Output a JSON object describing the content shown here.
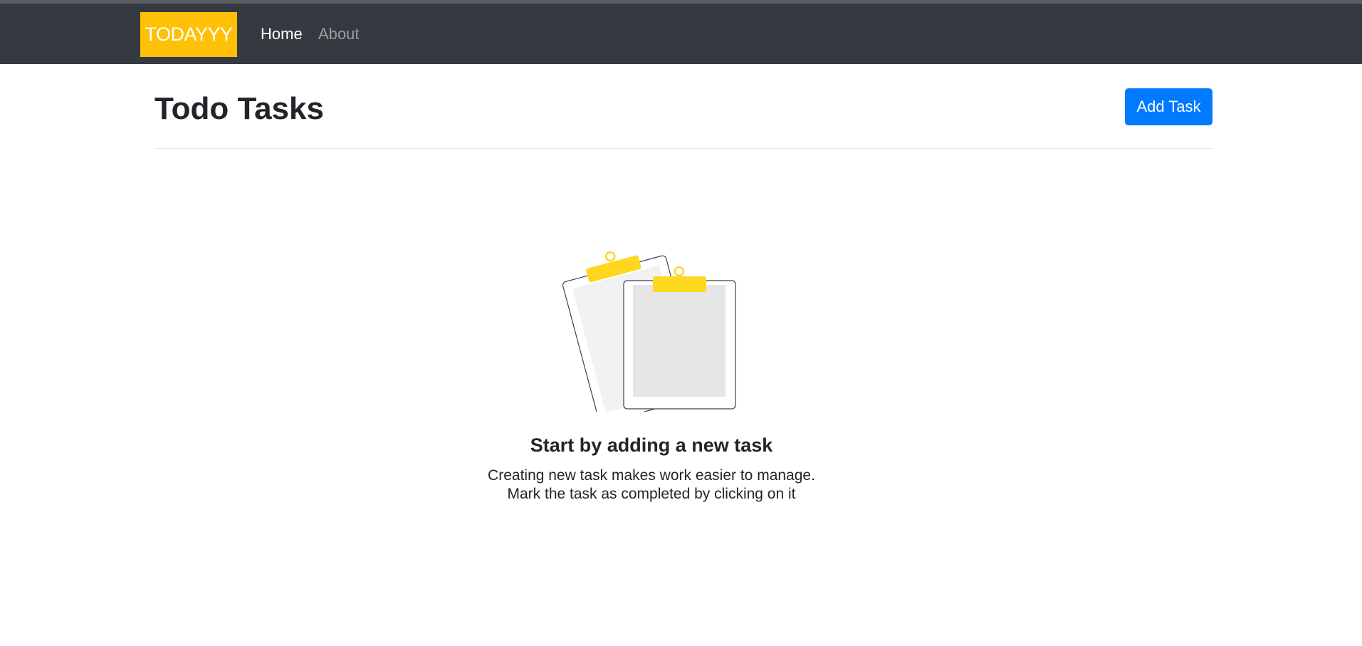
{
  "navbar": {
    "brand": "TODAYYY",
    "links": [
      {
        "label": "Home",
        "active": true
      },
      {
        "label": "About",
        "active": false
      }
    ],
    "background": "#343a40",
    "brand_color": "#ffc107"
  },
  "header": {
    "title": "Todo Tasks",
    "add_button_label": "Add Task",
    "add_button_color": "#007bff"
  },
  "empty_state": {
    "illustration": "clipboards-icon",
    "heading": "Start by adding a new task",
    "line1": "Creating new task makes work easier to manage.",
    "line2": "Mark the task as completed by clicking on it"
  }
}
